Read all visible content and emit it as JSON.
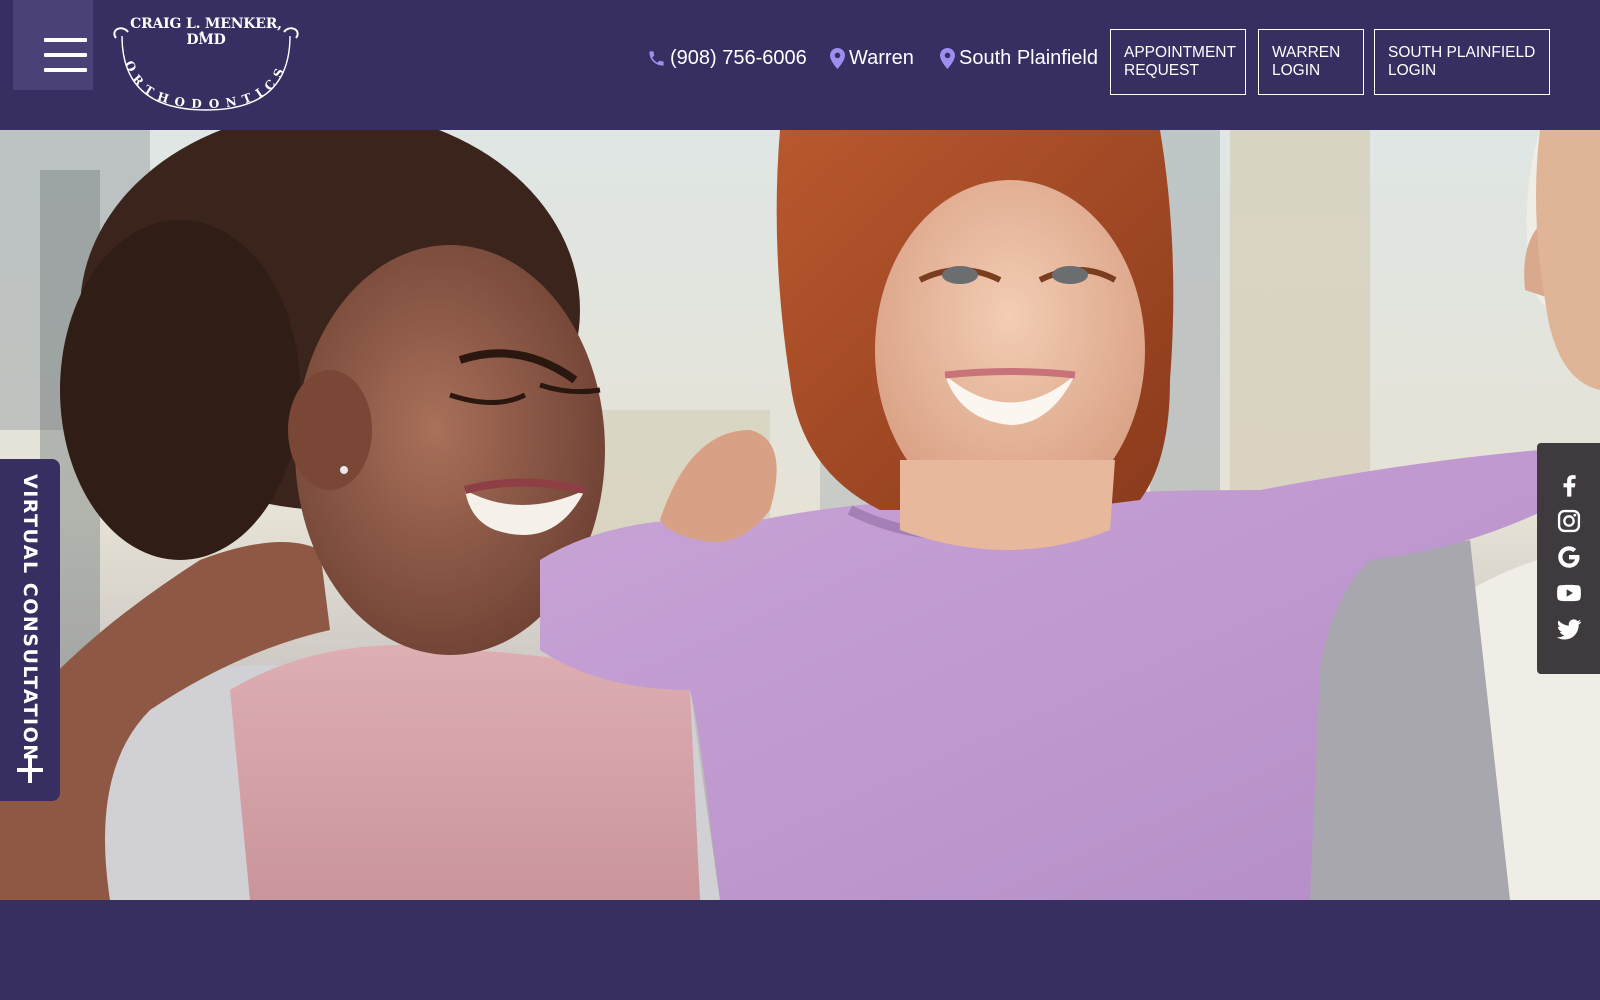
{
  "brand": {
    "logo_name": "CRAIG L. MENKER, DMD",
    "logo_tagline": "ORTHODONTICS",
    "colors": {
      "header_bg": "#372f61",
      "menu_button_bg": "#4a4277",
      "icon_accent": "#9d8ff0",
      "social_bar_bg": "#3e3a3e"
    }
  },
  "header": {
    "menu_icon": "hamburger-icon",
    "phone": {
      "icon": "phone-icon",
      "label": "(908) 756-6006"
    },
    "locations": [
      {
        "icon": "map-pin-icon",
        "label": "Warren"
      },
      {
        "icon": "map-pin-icon",
        "label": "South Plainfield"
      }
    ],
    "buttons": [
      {
        "line1": "APPOINTMENT",
        "line2": "REQUEST"
      },
      {
        "line1": "WARREN",
        "line2": "LOGIN"
      },
      {
        "line1": "SOUTH PLAINFIELD",
        "line2": "LOGIN"
      }
    ]
  },
  "hero": {
    "image": "photo of three smiling teenagers with arms around each other outdoors"
  },
  "virtual_consultation": {
    "label": "VIRTUAL CONSULTATION",
    "icon": "plus-icon"
  },
  "social": [
    "facebook-icon",
    "instagram-icon",
    "google-icon",
    "youtube-icon",
    "twitter-icon"
  ]
}
